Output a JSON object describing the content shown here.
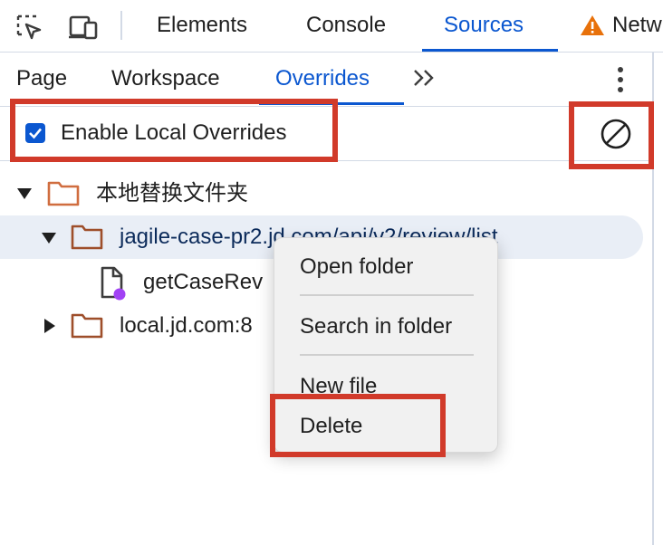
{
  "top_tabs": {
    "elements": "Elements",
    "console": "Console",
    "sources": "Sources",
    "network": "Netw",
    "network_icon": "warning-icon"
  },
  "sub_tabs": {
    "page": "Page",
    "workspace": "Workspace",
    "overrides": "Overrides",
    "more_icon": "double-chevron-right-icon"
  },
  "toolbar": {
    "enable_label": "Enable Local Overrides",
    "enable_checked": true,
    "clear_icon": "no-entry-icon"
  },
  "tree": [
    {
      "label": "本地替换文件夹",
      "expanded": true,
      "type": "folder"
    },
    {
      "label": "jagile-case-pr2.jd.com/api/v2/review/list",
      "expanded": true,
      "type": "folder",
      "selected": true
    },
    {
      "label": "getCaseRev",
      "type": "file"
    },
    {
      "label": "local.jd.com:8",
      "expanded": false,
      "type": "folder"
    }
  ],
  "context_menu": {
    "open_folder": "Open folder",
    "search_in_folder": "Search in folder",
    "new_file": "New file",
    "delete": "Delete"
  },
  "colors": {
    "accent": "#0b57d0",
    "highlight": "#d13a2a",
    "folder": "#b5603a",
    "warning": "#e8710a"
  }
}
